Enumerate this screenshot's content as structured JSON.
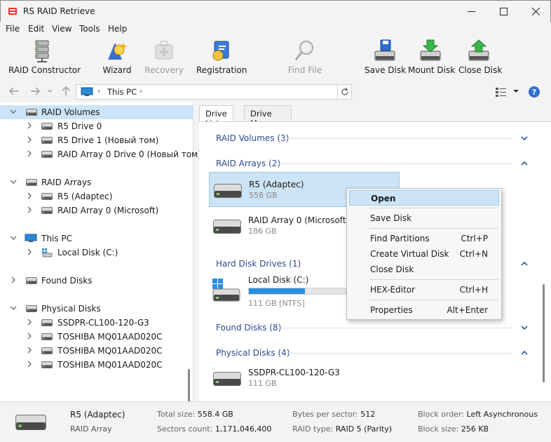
{
  "window": {
    "title": "RS RAID Retrieve"
  },
  "menu": [
    "File",
    "Edit",
    "View",
    "Tools",
    "Help"
  ],
  "toolbar": {
    "raid_constructor": "RAID Constructor",
    "wizard": "Wizard",
    "recovery": "Recovery",
    "registration": "Registration",
    "find_file": "Find File",
    "save_disk": "Save Disk",
    "mount_disk": "Mount Disk",
    "close_disk": "Close Disk"
  },
  "address": {
    "path": "This PC"
  },
  "tree": {
    "raid_volumes": "RAID Volumes",
    "rv_items": [
      "R5 Drive 0",
      "R5 Drive 1 (Новый том)",
      "RAID Array 0 Drive 0 (Новый том)"
    ],
    "raid_arrays": "RAID Arrays",
    "ra_items": [
      "R5 (Adaptec)",
      "RAID Array 0 (Microsoft)"
    ],
    "this_pc": "This PC",
    "pc_items": [
      "Local Disk (C:)"
    ],
    "found_disks": "Found Disks",
    "physical_disks": "Physical Disks",
    "pd_items": [
      "SSDPR-CL100-120-G3",
      "TOSHIBA MQ01AAD020C",
      "TOSHIBA MQ01AAD020C",
      "TOSHIBA MQ01AAD020C"
    ]
  },
  "tabs": {
    "drive_list": "Drive List",
    "drive_manager": "Drive Manager"
  },
  "list": {
    "raid_volumes": "RAID Volumes (3)",
    "raid_arrays": "RAID Arrays (2)",
    "r5_name": "R5 (Adaptec)",
    "r5_size": "558 GB",
    "r0_name": "RAID Array 0 (Microsoft)",
    "r0_size": "186 GB",
    "hdd": "Hard Disk Drives (1)",
    "local_name": "Local Disk (C:)",
    "local_size": "111 GB [NTFS]",
    "local_used_fraction": 0.58,
    "found": "Found Disks (8)",
    "physical": "Physical Disks (4)",
    "ssd_name": "SSDPR-CL100-120-G3",
    "ssd_size": "111 GB"
  },
  "context_menu": {
    "open": "Open",
    "save_disk": "Save Disk",
    "find_partitions": "Find Partitions",
    "find_partitions_key": "Ctrl+P",
    "create_virtual_disk": "Create Virtual Disk",
    "create_virtual_disk_key": "Ctrl+N",
    "close_disk": "Close Disk",
    "hex_editor": "HEX-Editor",
    "hex_editor_key": "Ctrl+H",
    "properties": "Properties",
    "properties_key": "Alt+Enter"
  },
  "status": {
    "name": "R5 (Adaptec)",
    "type": "RAID Array",
    "total_size_k": "Total size:",
    "total_size_v": "558.4 GB",
    "sectors_k": "Sectors count:",
    "sectors_v": "1,171,046,400",
    "bps_k": "Bytes per sector:",
    "bps_v": "512",
    "raid_type_k": "RAID type:",
    "raid_type_v": "RAID 5 (Parity)",
    "block_order_k": "Block order:",
    "block_order_v": "Left Asynchronous",
    "block_size_k": "Block size:",
    "block_size_v": "256 KB"
  },
  "colors": {
    "accent": "#2b8fe0",
    "selection": "#cce4f7",
    "section_text": "#2a4b8d"
  }
}
